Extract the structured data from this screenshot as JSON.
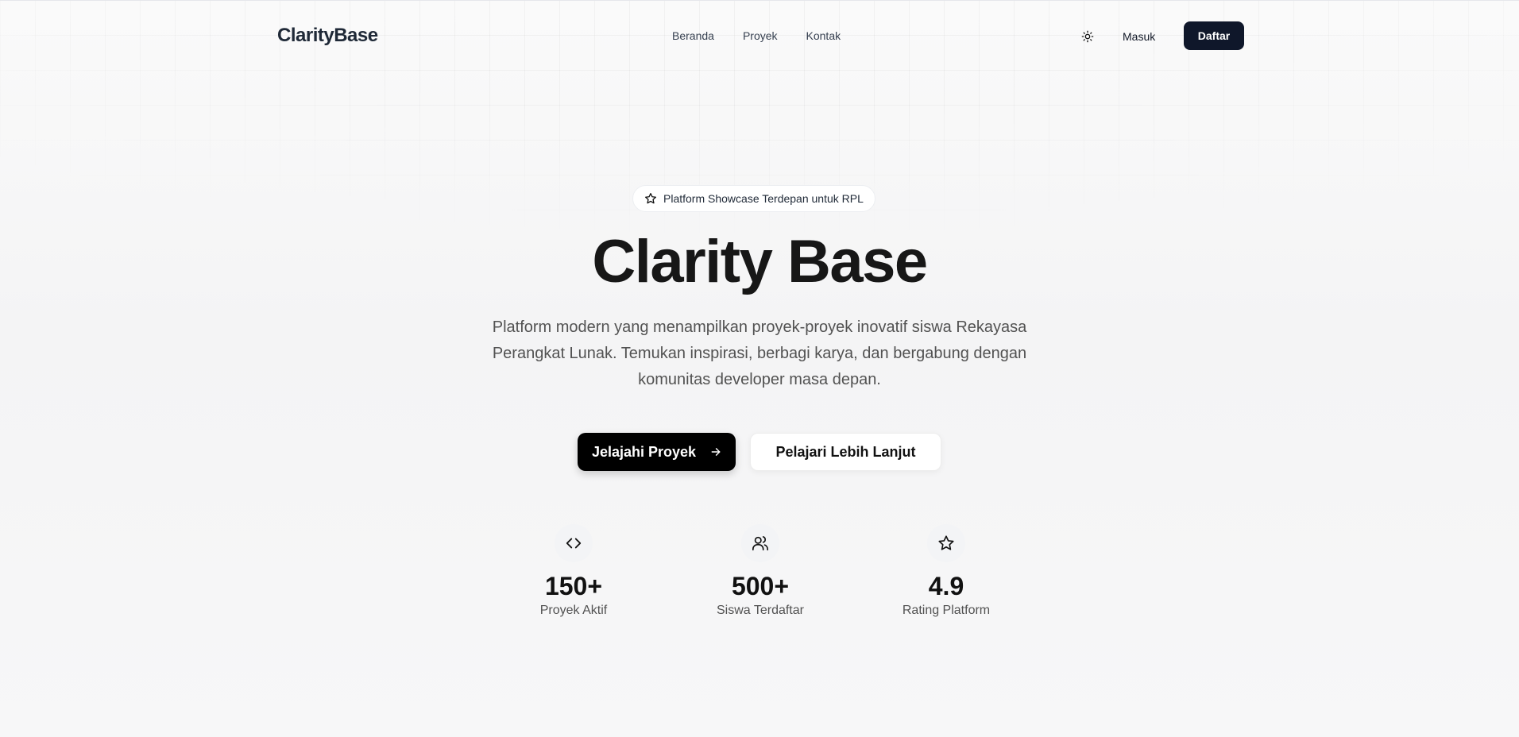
{
  "nav": {
    "brand": "ClarityBase",
    "links": [
      "Beranda",
      "Proyek",
      "Kontak"
    ],
    "theme_icon": "sun-icon",
    "login_label": "Masuk",
    "register_label": "Daftar"
  },
  "hero": {
    "badge_icon": "star-icon",
    "badge_text": "Platform Showcase Terdepan untuk RPL",
    "title": "Clarity Base",
    "description": "Platform modern yang menampilkan proyek-proyek inovatif siswa Rekayasa Perangkat Lunak. Temukan inspirasi, berbagi karya, dan bergabung dengan komunitas developer masa depan.",
    "primary_cta": "Jelajahi Proyek",
    "primary_cta_icon": "arrow-right-icon",
    "secondary_cta": "Pelajari Lebih Lanjut"
  },
  "stats": [
    {
      "icon": "code-icon",
      "value": "150+",
      "label": "Proyek Aktif"
    },
    {
      "icon": "users-icon",
      "value": "500+",
      "label": "Siswa Terdaftar"
    },
    {
      "icon": "star-icon",
      "value": "4.9",
      "label": "Rating Platform"
    }
  ],
  "colors": {
    "primary_button": "#000000",
    "register_button": "#0f172a",
    "background": "#f5f5f5"
  }
}
